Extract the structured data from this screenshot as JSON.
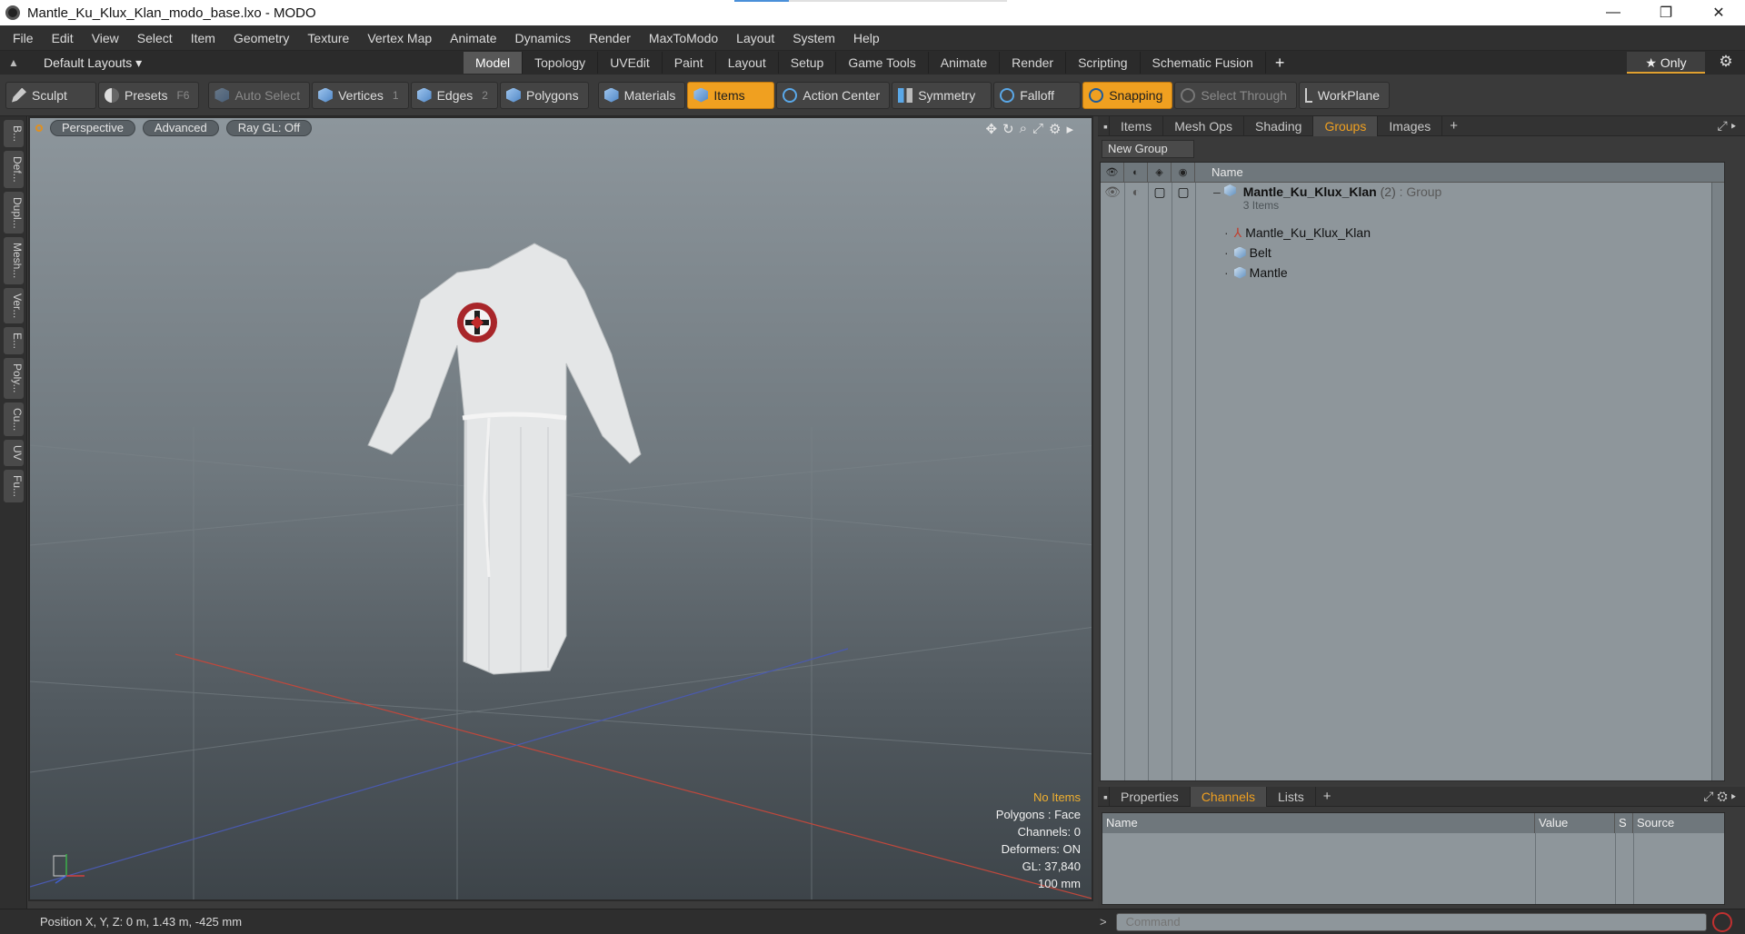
{
  "window": {
    "title": "Mantle_Ku_Klux_Klan_modo_base.lxo - MODO",
    "controls": [
      "—",
      "❐",
      "✕"
    ]
  },
  "menu": [
    "File",
    "Edit",
    "View",
    "Select",
    "Item",
    "Geometry",
    "Texture",
    "Vertex Map",
    "Animate",
    "Dynamics",
    "Render",
    "MaxToModo",
    "Layout",
    "System",
    "Help"
  ],
  "layouts": {
    "default_label": "Default Layouts ▾",
    "tabs": [
      "Model",
      "Topology",
      "UVEdit",
      "Paint",
      "Layout",
      "Setup",
      "Game Tools",
      "Animate",
      "Render",
      "Scripting",
      "Schematic Fusion"
    ],
    "active_tab": "Model",
    "add": "+",
    "only_label": "★  Only"
  },
  "toolbar": {
    "sculpt": "Sculpt",
    "presets": "Presets",
    "presets_key": "F6",
    "auto_select": "Auto Select",
    "vertices": "Vertices",
    "vertices_count": "1",
    "edges": "Edges",
    "edges_count": "2",
    "polygons": "Polygons",
    "materials": "Materials",
    "items": "Items",
    "action_center": "Action Center",
    "symmetry": "Symmetry",
    "falloff": "Falloff",
    "snapping": "Snapping",
    "select_through": "Select Through",
    "workplane": "WorkPlane"
  },
  "left_tabs": [
    "B...",
    "Def...",
    "Dupl...",
    "Mesh...",
    "Ver...",
    "E...",
    "Poly...",
    "Cu...",
    "UV",
    "Fu..."
  ],
  "viewport": {
    "view": "Perspective",
    "shading": "Advanced",
    "raygl": "Ray GL: Off",
    "info": {
      "no_items": "No Items",
      "polygons": "Polygons : Face",
      "channels": "Channels: 0",
      "deformers": "Deformers: ON",
      "gl": "GL: 37,840",
      "scale": "100 mm"
    }
  },
  "groups_panel": {
    "tabs": [
      "Items",
      "Mesh Ops",
      "Shading",
      "Groups",
      "Images"
    ],
    "active_tab": "Groups",
    "new_group": "New Group",
    "column_name": "Name",
    "group": {
      "name": "Mantle_Ku_Klux_Klan",
      "count": "(2)",
      "type": ": Group",
      "items_label": "3 Items"
    },
    "children": [
      "Mantle_Ku_Klux_Klan",
      "Belt",
      "Mantle"
    ]
  },
  "channels_panel": {
    "tabs": [
      "Properties",
      "Channels",
      "Lists"
    ],
    "active_tab": "Channels",
    "columns": [
      "Name",
      "Value",
      "S",
      "Source"
    ]
  },
  "status": {
    "position": "Position X, Y, Z:  0 m, 1.43 m, -425 mm",
    "command_placeholder": "Command"
  },
  "colors": {
    "accent": "#f0a020",
    "viewport_top": "#8d969c",
    "viewport_bottom": "#3d4449"
  }
}
